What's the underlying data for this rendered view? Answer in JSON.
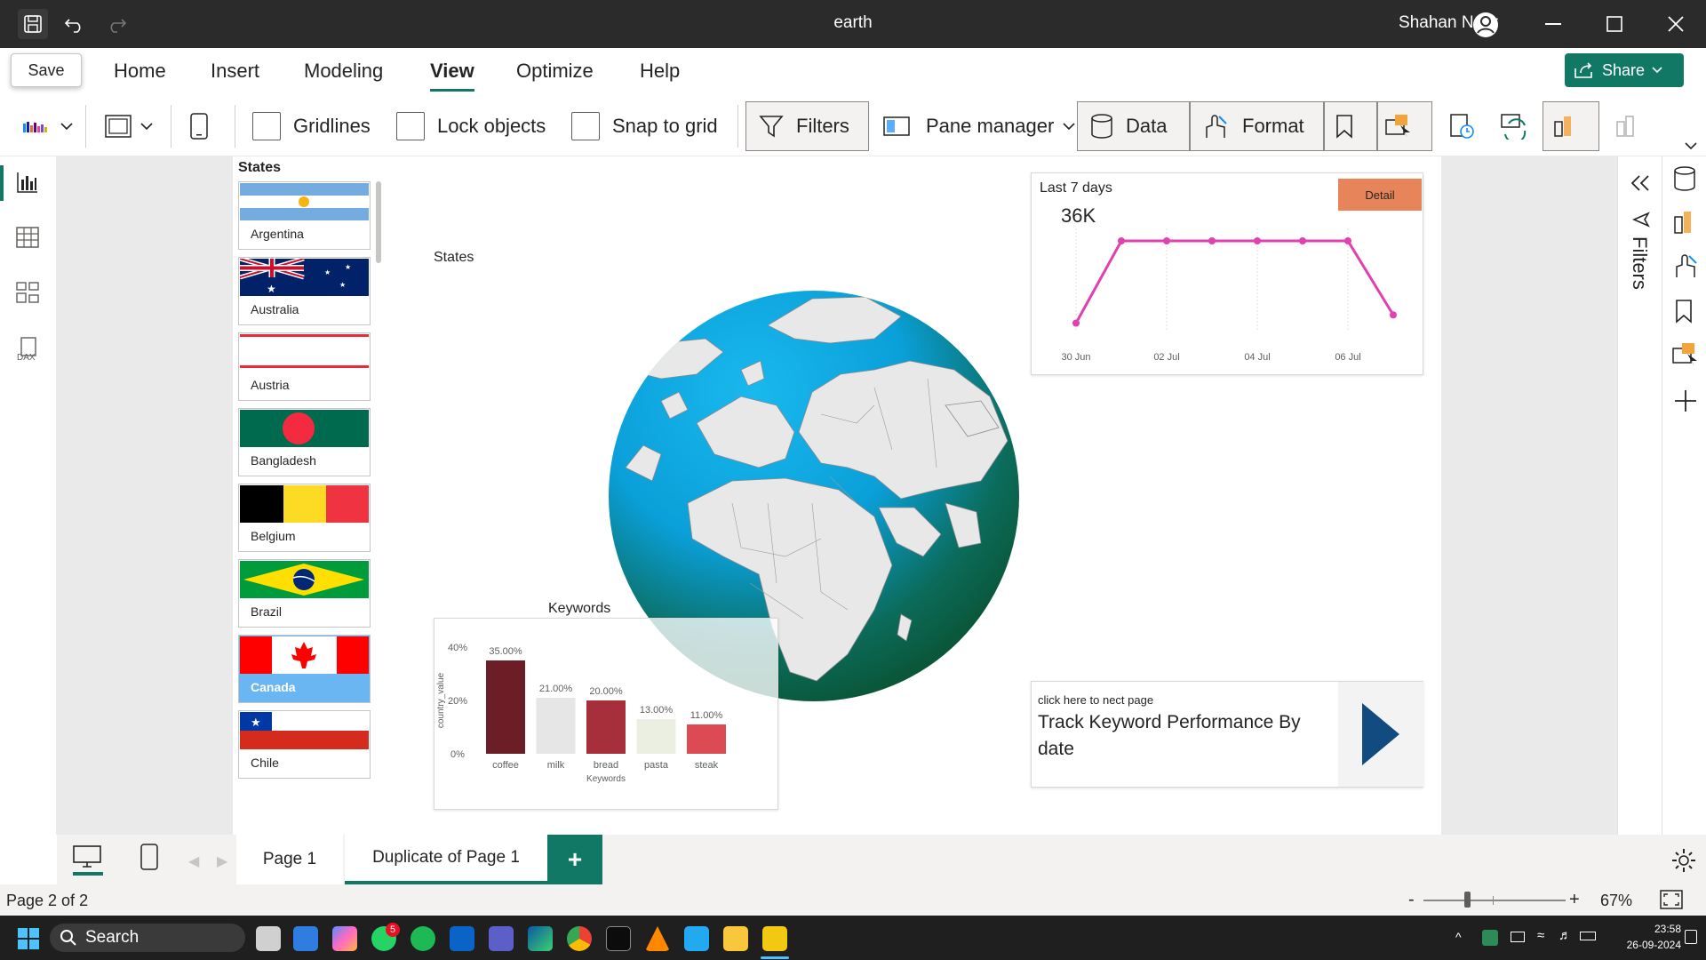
{
  "window": {
    "title": "earth",
    "user": "Shahan Noor",
    "save_tooltip": "Save"
  },
  "menu": {
    "items": [
      "Home",
      "Insert",
      "Modeling",
      "View",
      "Optimize",
      "Help"
    ],
    "active": "View",
    "share": "Share"
  },
  "ribbon": {
    "gridlines": "Gridlines",
    "lock_objects": "Lock objects",
    "snap_to_grid": "Snap to grid",
    "filters": "Filters",
    "pane_manager": "Pane manager",
    "data": "Data",
    "format": "Format"
  },
  "slicer": {
    "title": "States",
    "items": [
      {
        "name": "Argentina",
        "flag": "argentina"
      },
      {
        "name": "Australia",
        "flag": "australia"
      },
      {
        "name": "Austria",
        "flag": "austria"
      },
      {
        "name": "Bangladesh",
        "flag": "bangladesh"
      },
      {
        "name": "Belgium",
        "flag": "belgium"
      },
      {
        "name": "Brazil",
        "flag": "brazil"
      },
      {
        "name": "Canada",
        "flag": "canada",
        "selected": true
      },
      {
        "name": "Chile",
        "flag": "chile"
      }
    ]
  },
  "globe": {
    "title": "States"
  },
  "keywords_chart": {
    "title": "Keywords",
    "chart_data": {
      "type": "bar",
      "categories": [
        "coffee",
        "milk",
        "bread",
        "pasta",
        "steak"
      ],
      "values": [
        35.0,
        21.0,
        20.0,
        13.0,
        11.0
      ],
      "data_labels": [
        "35.00%",
        "21.00%",
        "20.00%",
        "13.00%",
        "11.00%"
      ],
      "colors": [
        "#6b1e26",
        "#e6e6e6",
        "#a72f3b",
        "#ebefe1",
        "#dc4a53"
      ],
      "xlabel": "Keywords",
      "ylabel": "country_value",
      "y_ticks": [
        "0%",
        "20%",
        "40%"
      ],
      "ylim": [
        0,
        40
      ]
    }
  },
  "kpi": {
    "label": "Last 7 days",
    "value": "36K",
    "detail_button": "Detail",
    "chart_data": {
      "type": "line",
      "x": [
        "30 Jun",
        "01 Jul",
        "02 Jul",
        "03 Jul",
        "04 Jul",
        "05 Jul",
        "06 Jul",
        "07 Jul"
      ],
      "y": [
        1,
        6,
        6,
        6,
        6,
        6,
        6,
        1.5
      ],
      "x_tick_labels": [
        "30 Jun",
        "02 Jul",
        "04 Jul",
        "06 Jul"
      ],
      "color": "#e040b0"
    }
  },
  "nav": {
    "caption": "click here to nect page",
    "title": "Track Keyword Performance By date"
  },
  "pages": {
    "tabs": [
      "Page 1",
      "Duplicate of Page 1"
    ],
    "active": "Duplicate of Page 1",
    "add": "+"
  },
  "status": {
    "page": "Page 2 of 2",
    "zoom": "67%",
    "zoom_minus": "-",
    "zoom_plus": "+"
  },
  "right_pane": {
    "filters": "Filters"
  },
  "taskbar": {
    "search": "Search",
    "time": "23:58",
    "date": "26-09-2024",
    "whatsapp_badge": "5"
  }
}
